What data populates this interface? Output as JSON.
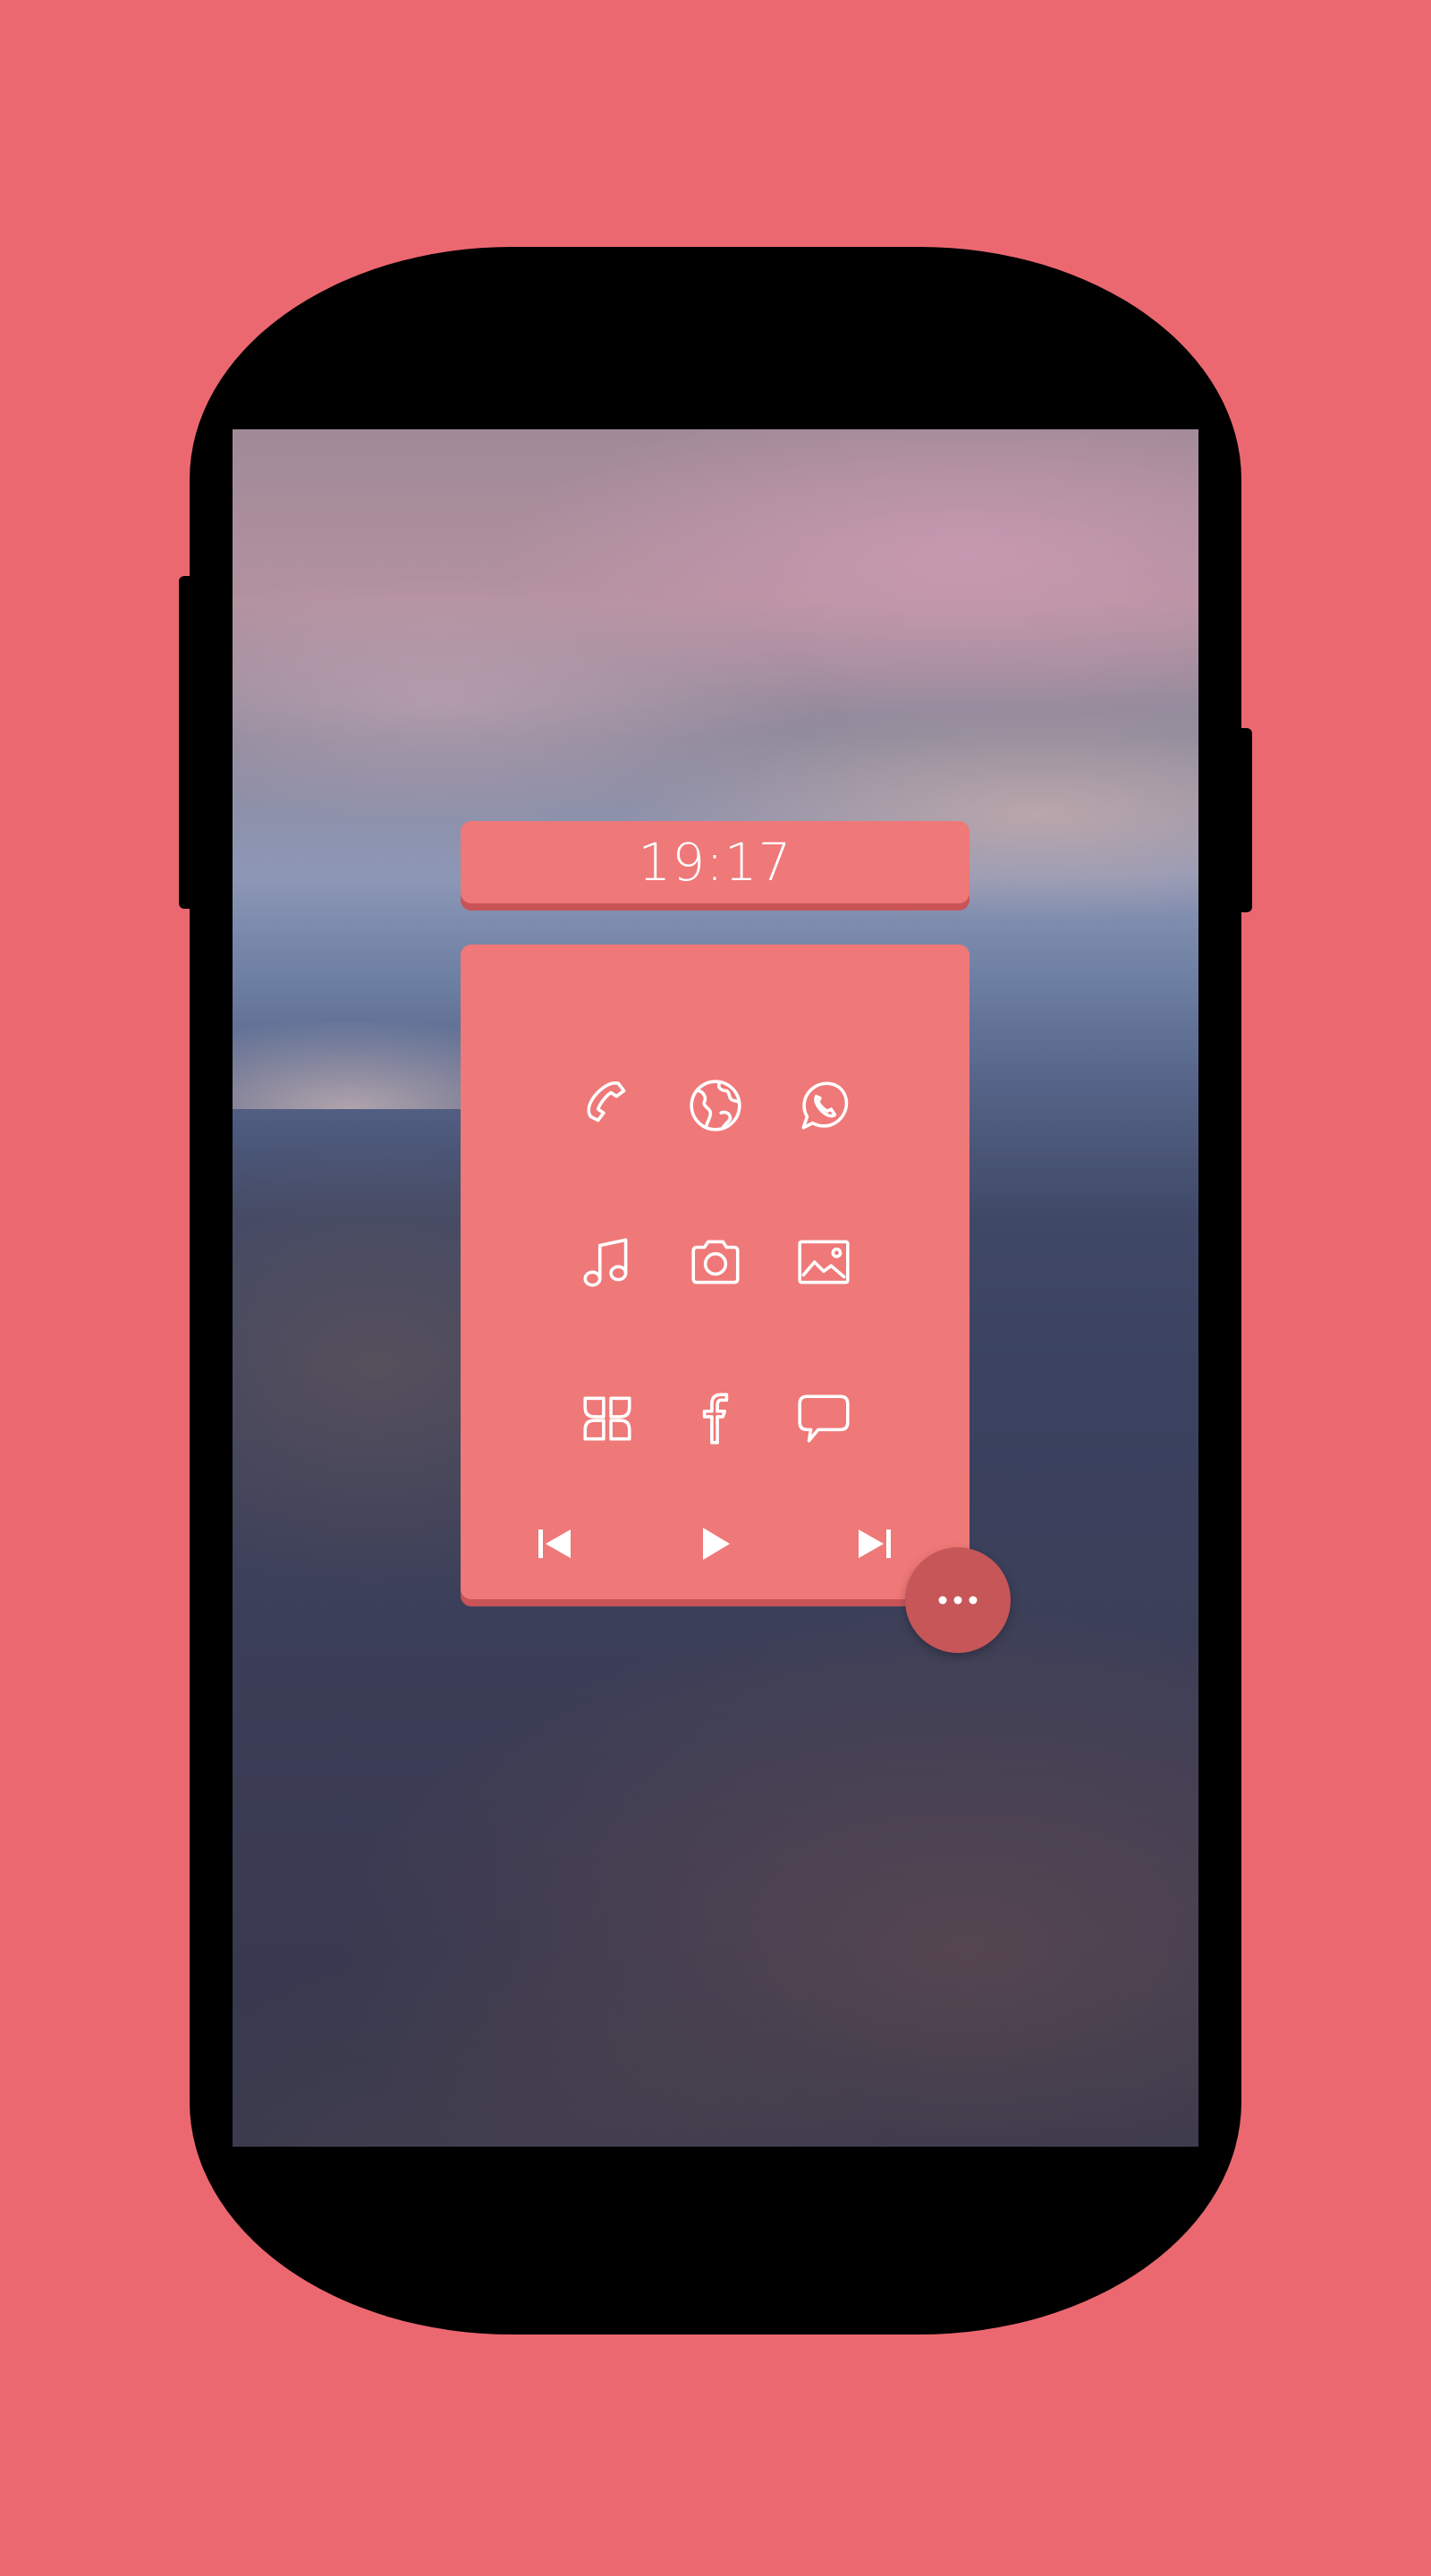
{
  "colors": {
    "background": "#ec6870",
    "card": "#ef7878",
    "card_shadow": "#c85458",
    "fab": "#c65658",
    "icon": "#ffffff"
  },
  "clock": {
    "time": "19:17"
  },
  "apps": [
    {
      "icon": "phone-icon"
    },
    {
      "icon": "globe-icon"
    },
    {
      "icon": "whatsapp-icon"
    },
    {
      "icon": "music-note-icon"
    },
    {
      "icon": "camera-icon"
    },
    {
      "icon": "gallery-icon"
    },
    {
      "icon": "app-grid-icon"
    },
    {
      "icon": "facebook-icon"
    },
    {
      "icon": "chat-bubble-icon"
    }
  ],
  "media_controls": [
    {
      "icon": "skip-previous-icon"
    },
    {
      "icon": "play-icon"
    },
    {
      "icon": "skip-next-icon"
    }
  ],
  "fab": {
    "icon": "more-horizontal-icon"
  }
}
